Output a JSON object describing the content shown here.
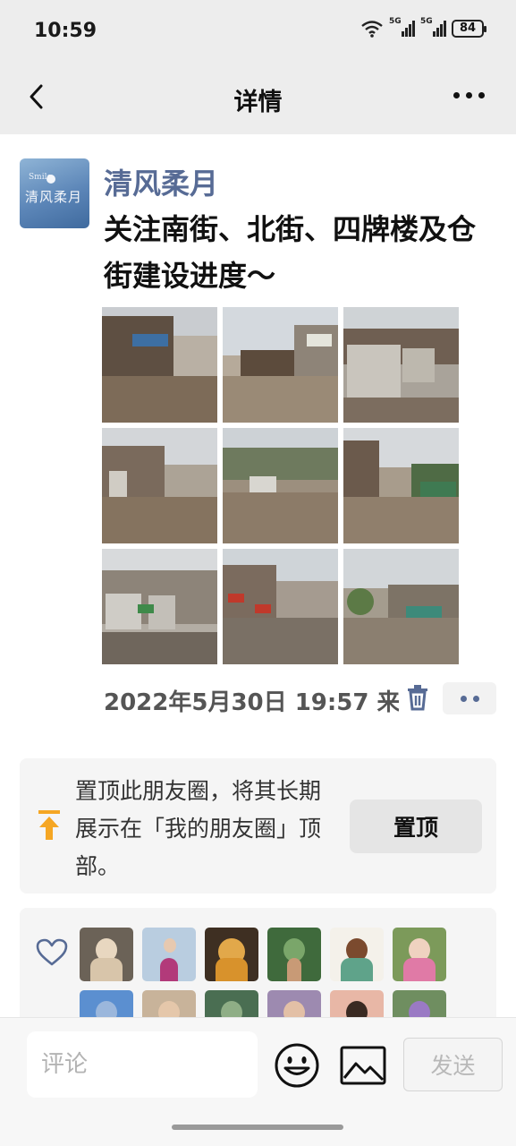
{
  "status_bar": {
    "time": "10:59",
    "battery": "84",
    "signal_labels": [
      "5G",
      "5G"
    ]
  },
  "nav": {
    "title": "详情",
    "back_icon": "chevron-left-icon",
    "more_icon": "more-dots-icon"
  },
  "post": {
    "username": "清风柔月",
    "avatar_text": "Smile 清风柔月",
    "text": "关注南街、北街、四牌楼及仓街建设进度～",
    "photo_count": 9,
    "time": "2022年5月30日 19:57 来自",
    "icons": [
      "trash-icon",
      "more-dots-icon"
    ],
    "colors": {
      "username": "#576b95",
      "accent_icon": "#576b95"
    }
  },
  "pin": {
    "text": "置顶此朋友圈，将其长期展示在「我的朋友圈」顶部。",
    "button_label": "置顶",
    "icon": "pin-top-icon",
    "icon_color": "#f5a623"
  },
  "likes": {
    "icon": "heart-icon",
    "liker_count_visible": 12
  },
  "comment_bar": {
    "placeholder": "评论",
    "send_label": "发送",
    "icons": [
      "emoji-icon",
      "image-icon"
    ]
  }
}
